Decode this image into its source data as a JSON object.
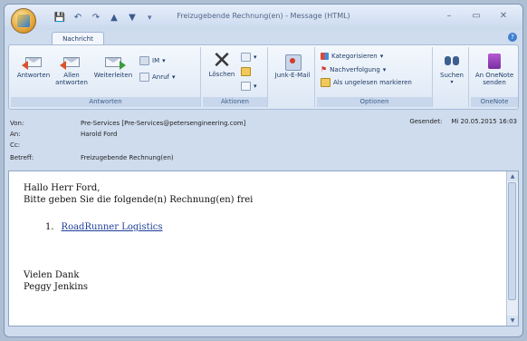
{
  "window": {
    "title": "Freizugebende Rechnung(en) - Message (HTML)",
    "controls": {
      "minimize": "–",
      "maximize": "▭",
      "close": "✕"
    }
  },
  "qat": {
    "save": "💾",
    "undo": "↶",
    "redo": "↷",
    "up": "▲",
    "down": "▼",
    "more": "▾"
  },
  "tabs": [
    {
      "label": "Nachricht"
    }
  ],
  "help": "?",
  "ribbon": {
    "respond": {
      "label": "Antworten",
      "reply": "Antworten",
      "reply_all": "Allen antworten",
      "forward": "Weiterleiten",
      "im": "IM",
      "call": "Anruf"
    },
    "actions": {
      "label": "Aktionen",
      "delete": "Löschen"
    },
    "junk": {
      "label": "Junk-E-Mail"
    },
    "options": {
      "label": "Optionen",
      "categorize": "Kategorisieren",
      "followup": "Nachverfolgung",
      "mark_unread": "Als ungelesen markieren"
    },
    "find": {
      "label": "Suchen"
    },
    "onenote": {
      "label": "OneNote",
      "send": "An OneNote senden"
    }
  },
  "header": {
    "from_label": "Von:",
    "from_value": "Pre-Services [Pre-Services@petersengineering.com]",
    "to_label": "An:",
    "to_value": "Harold Ford",
    "cc_label": "Cc:",
    "cc_value": "",
    "subject_label": "Betreff:",
    "subject_value": "Freizugebende Rechnung(en)",
    "sent_label": "Gesendet:",
    "sent_value": "Mi 20.05.2015 16:03"
  },
  "body": {
    "greeting": "Hallo Herr Ford,",
    "line1": "Bitte geben Sie die folgende(n) Rechnung(en) frei",
    "list": [
      {
        "number": "1.",
        "text": "RoadRunner Logistics"
      }
    ],
    "closing": "Vielen Dank",
    "signature": "Peggy Jenkins"
  },
  "colors": {
    "accent": "#3f7fd0",
    "ribbon_bg": "#dce7f5",
    "link": "#1f3f9a"
  }
}
